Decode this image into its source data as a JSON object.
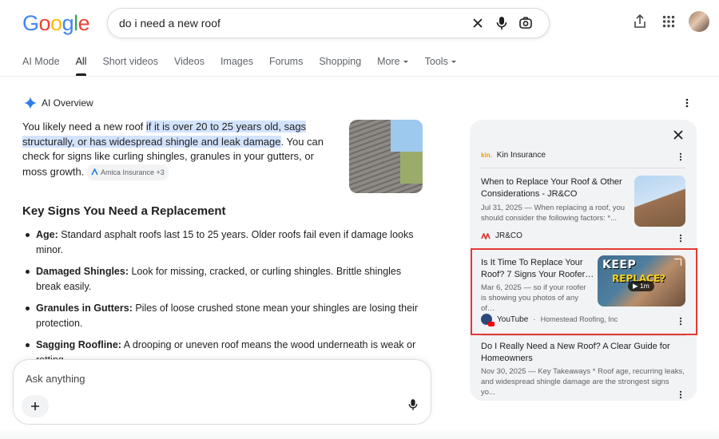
{
  "header": {
    "logo_letters": [
      "G",
      "o",
      "o",
      "g",
      "l",
      "e"
    ],
    "logo_colors": [
      "#4285F4",
      "#EA4335",
      "#FBBC05",
      "#4285F4",
      "#34A853",
      "#EA4335"
    ],
    "query": "do i need a new roof"
  },
  "tabs": [
    {
      "label": "AI Mode"
    },
    {
      "label": "All",
      "active": true
    },
    {
      "label": "Short videos"
    },
    {
      "label": "Videos"
    },
    {
      "label": "Images"
    },
    {
      "label": "Forums"
    },
    {
      "label": "Shopping"
    },
    {
      "label": "More",
      "dropdown": true
    },
    {
      "label": "Tools",
      "dropdown": true
    }
  ],
  "ai_overview": {
    "title": "AI Overview",
    "summary_pre": "You likely need a new roof ",
    "summary_highlight": "if it is over 20 to 25 years old, sags structurally, or has widespread shingle and leak damage",
    "summary_post": ". You can check for signs like curling shingles, granules in your gutters, or moss growth.",
    "citation": "Amica Insurance +3",
    "section_heading": "Key Signs You Need a Replacement",
    "bullets": [
      {
        "term": "Age:",
        "text": " Standard asphalt roofs last 15 to 25 years. Older roofs fail even if damage looks minor."
      },
      {
        "term": "Damaged Shingles:",
        "text": " Look for missing, cracked, or curling shingles. Brittle shingles break easily."
      },
      {
        "term": "Granules in Gutters:",
        "text": " Piles of loose crushed stone mean your shingles are losing their protection."
      },
      {
        "term": "Sagging Roofline:",
        "text": " A drooping or uneven roof means the wood underneath is weak or rotting."
      }
    ]
  },
  "ask": {
    "placeholder": "Ask anything"
  },
  "sources": {
    "top_source": "Kin Insurance",
    "top_source_logo": "kin.",
    "cards": [
      {
        "title": "When to Replace Your Roof & Other Considerations - JR&CO",
        "snippet": "Jul 31, 2025 — When replacing a roof, you should consider the following factors: *...",
        "source": "JR&CO"
      },
      {
        "title": "Is It Time To Replace Your Roof? 7 Signs Your Roofer…",
        "snippet": "Mar 6, 2025 — so if your roofer is showing you photos of any of…",
        "source": "YouTube",
        "channel": "Homestead Roofing, Inc",
        "thumb_text_1": "KEEP",
        "thumb_text_2": "REPLACE?",
        "duration": "1m"
      },
      {
        "title": "Do I Really Need a New Roof? A Clear Guide for Homeowners",
        "snippet": "Nov 30, 2025 — Key Takeaways * Roof age, recurring leaks, and widespread shingle damage are the strongest signs yo..."
      }
    ]
  }
}
